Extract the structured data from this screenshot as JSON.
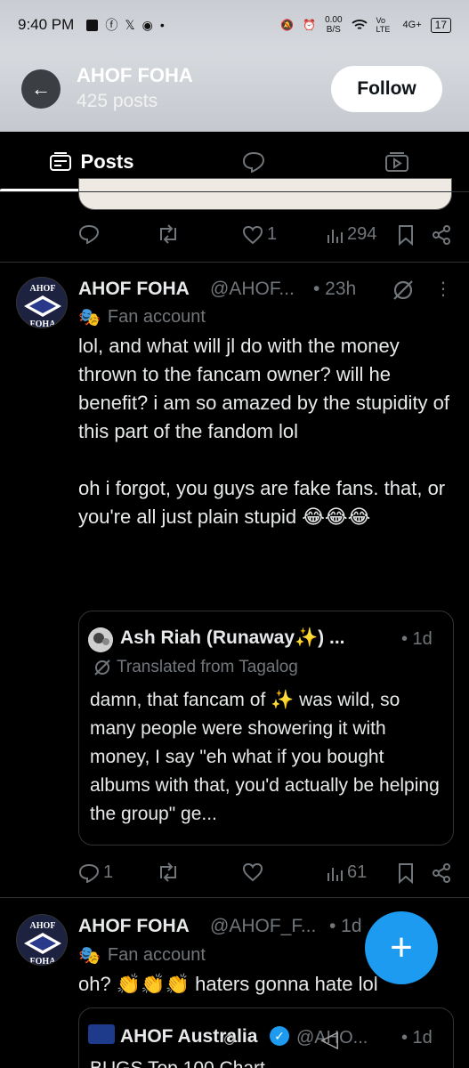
{
  "status_bar": {
    "time": "9:40 PM",
    "net_speed": "0.00",
    "net_unit": "B/S",
    "volte": "Vo LTE",
    "signal": "4G+",
    "battery": "17"
  },
  "header": {
    "name": "AHOF FOHA",
    "posts_count": "425 posts",
    "follow_label": "Follow"
  },
  "tabs": {
    "posts_label": "Posts"
  },
  "prev_tweet": {
    "replies": "",
    "retweets": "",
    "likes": "1",
    "views": "294"
  },
  "tweets": [
    {
      "avatar_top": "AHOF",
      "avatar_bottom": "FOHA",
      "name": "AHOF FOHA",
      "handle": "@AHOF...",
      "time": "• 23h",
      "label": "Fan account",
      "body": "lol, and what will jl do with the money thrown to the fancam owner? will he benefit? i am so amazed by the stupidity of this part of the fandom lol\n\noh i forgot, you guys are fake fans. that, or you're all just plain stupid 😂😂😂",
      "quote": {
        "name": "Ash Riah (Runaway✨) ...",
        "time": "• 1d",
        "translated": "Translated from Tagalog",
        "body": "damn, that fancam of ✨ was wild, so many people were showering it with money, I say \"eh what if you bought albums with that, you'd actually be helping the group\" ge..."
      },
      "replies": "1",
      "retweets": "",
      "likes": "",
      "views": "61"
    },
    {
      "avatar_top": "AHOF",
      "avatar_bottom": "FOHA",
      "name": "AHOF FOHA",
      "handle": "@AHOF_F...",
      "time": "• 1d",
      "label": "Fan account",
      "body": "oh? 👏👏👏 haters gonna hate lol",
      "quote": {
        "name": "AHOF Australia",
        "handle": "@AHO...",
        "time": "• 1d",
        "body": "BUGS Top 100 Chart ..."
      }
    }
  ],
  "colors": {
    "accent": "#1d9bf0",
    "muted": "#71767b",
    "background": "#000000"
  }
}
